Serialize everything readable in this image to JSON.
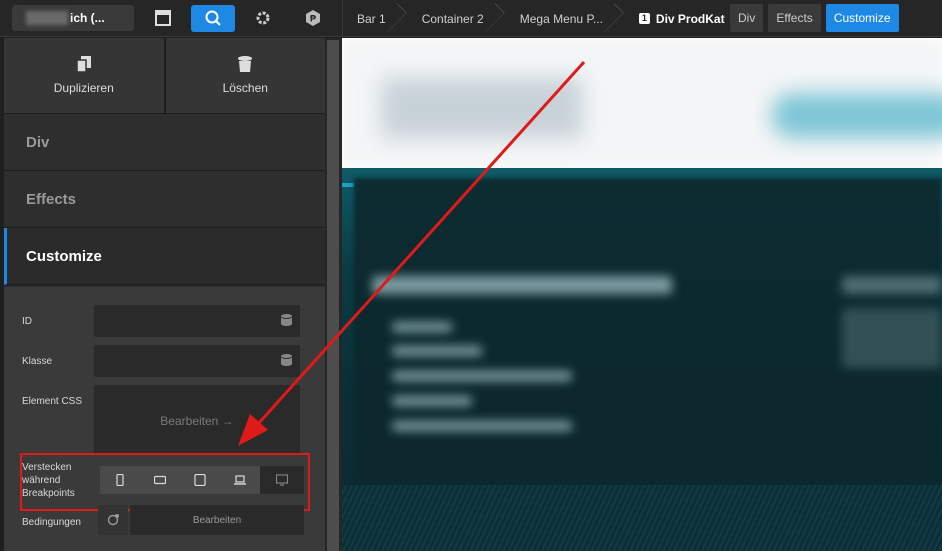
{
  "topbar": {
    "site_title": "ich (...",
    "icons": [
      "window-icon",
      "search-icon",
      "gear-icon",
      "plugin-icon"
    ]
  },
  "breadcrumb": {
    "items": [
      "Bar 1",
      "Container 2",
      "Mega Menu P...",
      "Div ProdKat"
    ],
    "current_badge": "1"
  },
  "tabs": [
    "Div",
    "Effects",
    "Customize"
  ],
  "actions": {
    "duplicate": "Duplizieren",
    "delete": "Löschen"
  },
  "sections": [
    "Div",
    "Effects",
    "Customize"
  ],
  "form": {
    "id_label": "ID",
    "class_label": "Klasse",
    "css_label": "Element CSS",
    "css_edit": "Bearbeiten →",
    "hide_label": "Verstecken während Breakpoints",
    "conditions_label": "Bedingungen",
    "conditions_edit": "Bearbeiten",
    "breakpoints": [
      "phone-portrait-icon",
      "phone-landscape-icon",
      "tablet-icon",
      "laptop-icon",
      "desktop-icon"
    ]
  },
  "colors": {
    "accent": "#1e88e5",
    "annotation": "#e01919"
  }
}
